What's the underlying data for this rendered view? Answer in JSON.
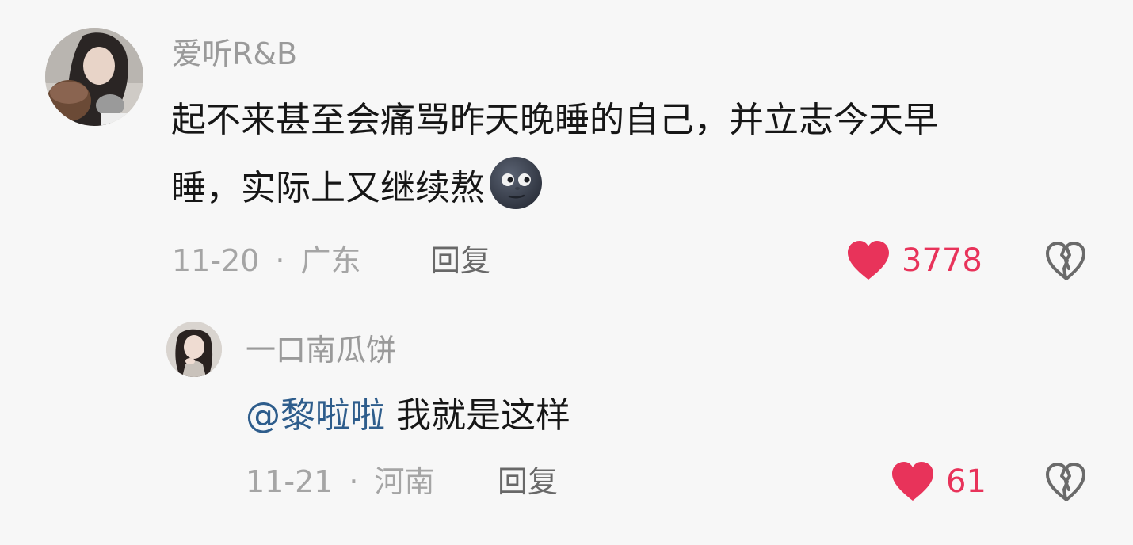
{
  "comment": {
    "username": "爱听R&B",
    "text_line1": "起不来甚至会痛骂昨天晚睡的自己，并立志今天早",
    "text_line2": "睡，实际上又继续熬",
    "date": "11-20",
    "separator": "·",
    "location": "广东",
    "reply_label": "回复",
    "like_count": "3778",
    "emoji": "new-moon-face-emoji",
    "like_icon": "heart-icon",
    "dislike_icon": "broken-heart-icon"
  },
  "reply": {
    "username": "一口南瓜饼",
    "mention": "@黎啦啦",
    "text": " 我就是这样",
    "date": "11-21",
    "separator": "·",
    "location": "河南",
    "reply_label": "回复",
    "like_count": "61",
    "like_icon": "heart-icon",
    "dislike_icon": "broken-heart-icon"
  },
  "colors": {
    "background": "#f7f7f7",
    "username": "#9a9a9a",
    "meta": "#a5a5a5",
    "like": "#e8335a",
    "mention": "#2e5d8c"
  }
}
